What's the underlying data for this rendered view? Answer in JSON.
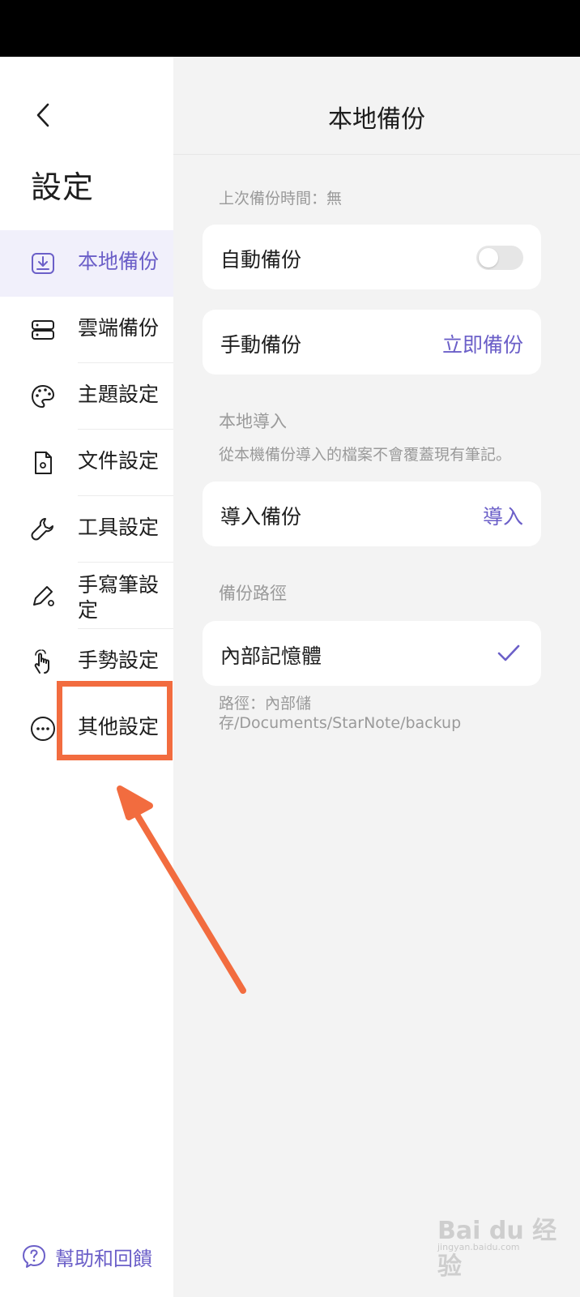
{
  "sidebar": {
    "title": "設定",
    "items": [
      {
        "label": "本地備份",
        "icon": "local-backup-icon",
        "active": true
      },
      {
        "label": "雲端備份",
        "icon": "cloud-backup-icon"
      },
      {
        "label": "主題設定",
        "icon": "palette-icon"
      },
      {
        "label": "文件設定",
        "icon": "document-settings-icon"
      },
      {
        "label": "工具設定",
        "icon": "wrench-icon"
      },
      {
        "label": "手寫筆設定",
        "icon": "pen-settings-icon"
      },
      {
        "label": "手勢設定",
        "icon": "gesture-hand-icon"
      },
      {
        "label": "其他設定",
        "icon": "more-dots-icon"
      }
    ],
    "help_label": "幫助和回饋"
  },
  "main": {
    "title": "本地備份",
    "last_backup": "上次備份時間：無",
    "auto_backup": {
      "label": "自動備份",
      "enabled": false
    },
    "manual_backup": {
      "label": "手動備份",
      "action": "立即備份"
    },
    "import_section": {
      "title": "本地導入",
      "subtitle": "從本機備份導入的檔案不會覆蓋現有筆記。"
    },
    "import_backup": {
      "label": "導入備份",
      "action": "導入"
    },
    "path_section": {
      "title": "備份路徑"
    },
    "internal_storage": {
      "label": "內部記憶體",
      "selected": true
    },
    "path_note": "路徑：內部儲存/Documents/StarNote/backup"
  },
  "watermark": {
    "brand": "Bai du 经验",
    "sub": "jingyan.baidu.com"
  },
  "colors": {
    "accent": "#6b5fc8",
    "highlight": "#f26c3f",
    "active_bg": "#f1f0fb"
  }
}
